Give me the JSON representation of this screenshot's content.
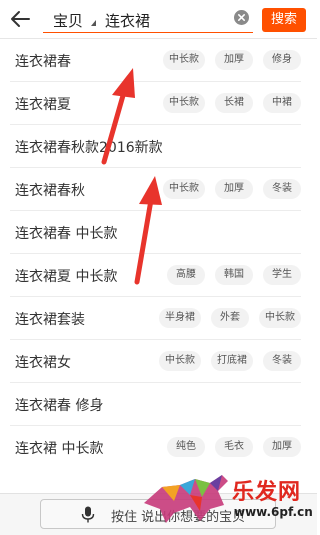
{
  "header": {
    "scope_label": "宝贝",
    "query": "连衣裙",
    "search_label": "搜索"
  },
  "suggestions": [
    {
      "label": "连衣裙春",
      "tags": [
        "中长款",
        "加厚",
        "修身"
      ]
    },
    {
      "label": "连衣裙夏",
      "tags": [
        "中长款",
        "长裙",
        "中裙"
      ]
    },
    {
      "label": "连衣裙春秋款2016新款",
      "tags": []
    },
    {
      "label": "连衣裙春秋",
      "tags": [
        "中长款",
        "加厚",
        "冬装"
      ]
    },
    {
      "label": "连衣裙春 中长款",
      "tags": []
    },
    {
      "label": "连衣裙夏 中长款",
      "tags": [
        "高腰",
        "韩国",
        "学生"
      ]
    },
    {
      "label": "连衣裙套装",
      "tags": [
        "半身裙",
        "外套",
        "中长款"
      ]
    },
    {
      "label": "连衣裙女",
      "tags": [
        "中长款",
        "打底裙",
        "冬装"
      ]
    },
    {
      "label": "连衣裙春 修身",
      "tags": []
    },
    {
      "label": "连衣裙 中长款",
      "tags": [
        "纯色",
        "毛衣",
        "加厚"
      ]
    }
  ],
  "voice": {
    "label": "按住 说出你想要的宝贝"
  },
  "watermark": {
    "brand": "乐发网",
    "url": "www.6pf.cn"
  },
  "colors": {
    "accent": "#ff5000",
    "arrow": "#e8342c"
  }
}
